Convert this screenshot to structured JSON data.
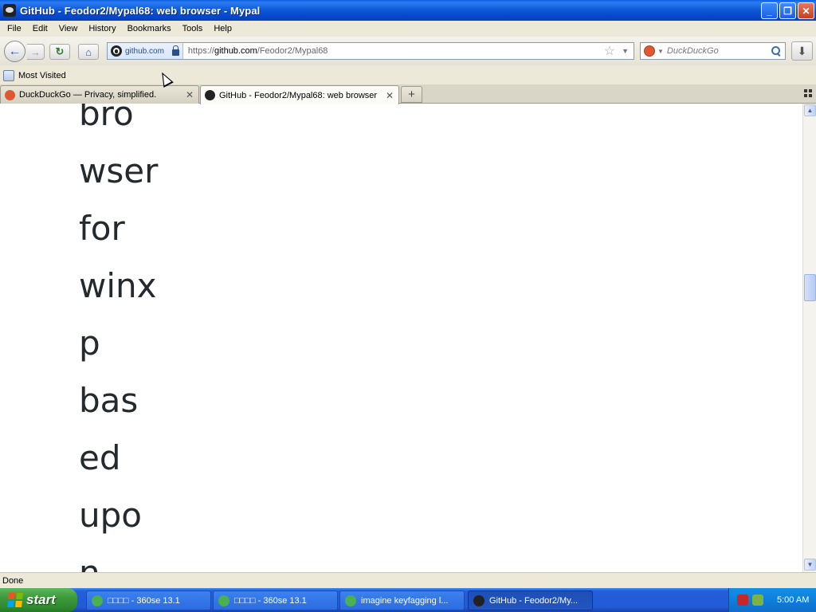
{
  "window": {
    "title": "GitHub - Feodor2/Mypal68: web browser - Mypal",
    "minimize": "_",
    "maximize": "❐",
    "close": "✕"
  },
  "menu": [
    "File",
    "Edit",
    "View",
    "History",
    "Bookmarks",
    "Tools",
    "Help"
  ],
  "navbar": {
    "identity": "github.com",
    "url_prefix": "https://",
    "url_domain": "github.com",
    "url_path": "/Feodor2/Mypal68",
    "search_placeholder": "DuckDuckGo"
  },
  "bookmarks": {
    "most_visited": "Most Visited"
  },
  "tabs": [
    {
      "label": "DuckDuckGo — Privacy, simplified.",
      "close": "✕",
      "icon_color": "#de5833",
      "active": false
    },
    {
      "label": "GitHub - Feodor2/Mypal68: web browser",
      "close": "✕",
      "icon_color": "#222222",
      "active": true
    }
  ],
  "newtab": "+",
  "content": {
    "words": [
      "bro",
      "wser",
      "for",
      "winx",
      "p",
      "bas",
      "ed",
      "upo",
      "n"
    ]
  },
  "status": "Done",
  "taskbar": {
    "start": "start",
    "tasks": [
      {
        "label": "□□□□ - 360se 13.1",
        "icon_color": "#4caf50",
        "active": false
      },
      {
        "label": "□□□□ - 360se 13.1",
        "icon_color": "#4caf50",
        "active": false
      },
      {
        "label": "imagine keyfagging l...",
        "icon_color": "#4caf50",
        "active": false
      },
      {
        "label": "GitHub - Feodor2/My...",
        "icon_color": "#222222",
        "active": true
      }
    ],
    "clock": "5:00 AM"
  },
  "colors": {
    "titlebar": "#0b57d8",
    "taskbar": "#225bd6",
    "start": "#3c9a3c",
    "page_text": "#24292e"
  }
}
